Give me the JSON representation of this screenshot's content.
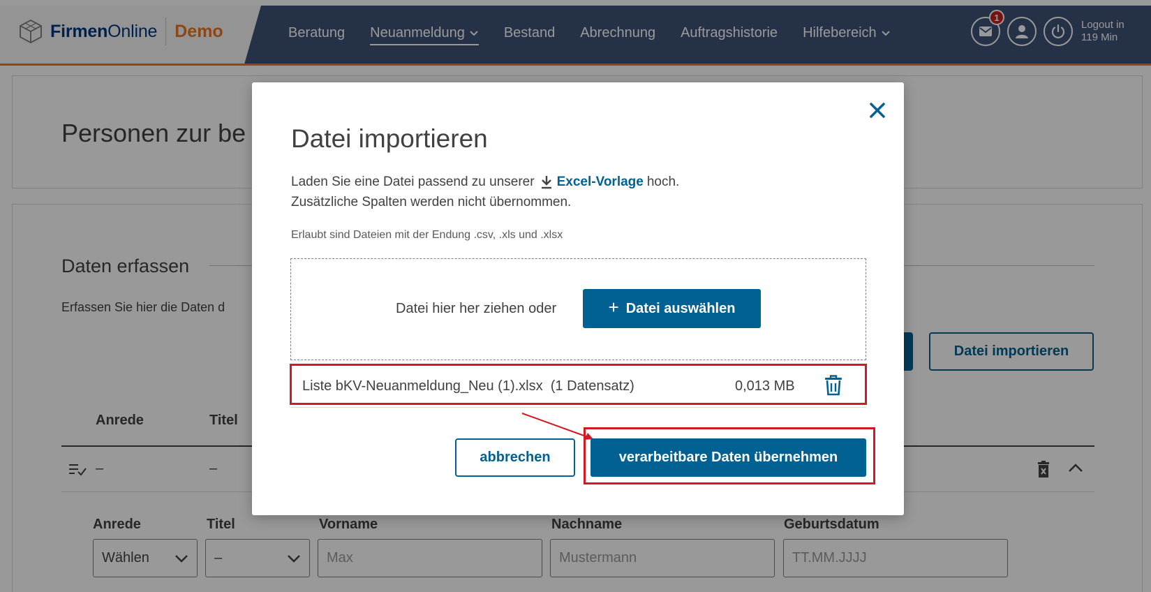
{
  "header": {
    "logo_bold": "Firmen",
    "logo_light": "Online",
    "logo_demo": "Demo",
    "nav": [
      {
        "label": "Beratung"
      },
      {
        "label": "Neuanmeldung"
      },
      {
        "label": "Bestand"
      },
      {
        "label": "Abrechnung"
      },
      {
        "label": "Auftragshistorie"
      },
      {
        "label": "Hilfebereich"
      }
    ],
    "mail_badge": "1",
    "logout_line1": "Logout in",
    "logout_line2": "119 Min",
    "colors": {
      "navy": "#3f5275",
      "accent_orange": "#e87722",
      "badge_red": "#c81e1e"
    }
  },
  "page": {
    "title": "Personen zur be",
    "section_title": "Daten erfassen",
    "section_desc": "Erfassen Sie hier die Daten d",
    "import_button": "Datei importieren",
    "table_headers": {
      "anrede": "Anrede",
      "titel": "Titel"
    },
    "row": {
      "anrede": "–",
      "titel": "–"
    },
    "form": {
      "anrede_label": "Anrede",
      "titel_label": "Titel",
      "vorname_label": "Vorname",
      "nachname_label": "Nachname",
      "geburtsdatum_label": "Geburtsdatum",
      "anrede_value": "Wählen",
      "titel_value": "–",
      "vorname_placeholder": "Max",
      "nachname_placeholder": "Mustermann",
      "geburtsdatum_placeholder": "TT.MM.JJJJ"
    }
  },
  "modal": {
    "title": "Datei importieren",
    "text_before_link": "Laden Sie eine Datei passend zu unserer",
    "link_label": "Excel-Vorlage",
    "text_after_link": "hoch.",
    "text_line2": "Zusätzliche Spalten werden nicht übernommen.",
    "hint": "Erlaubt sind Dateien mit der Endung .csv, .xls und .xlsx",
    "drop_text": "Datei hier her ziehen oder",
    "choose_plus": "+",
    "choose_label": "Datei auswählen",
    "file": {
      "name": "Liste bKV-Neuanmeldung_Neu (1).xlsx  (1 Datensatz)",
      "size": "0,013 MB"
    },
    "cancel_label": "abbrechen",
    "apply_label": "verarbeitbare Daten übernehmen",
    "colors": {
      "primary": "#006192",
      "highlight_red": "#d11a24"
    }
  }
}
